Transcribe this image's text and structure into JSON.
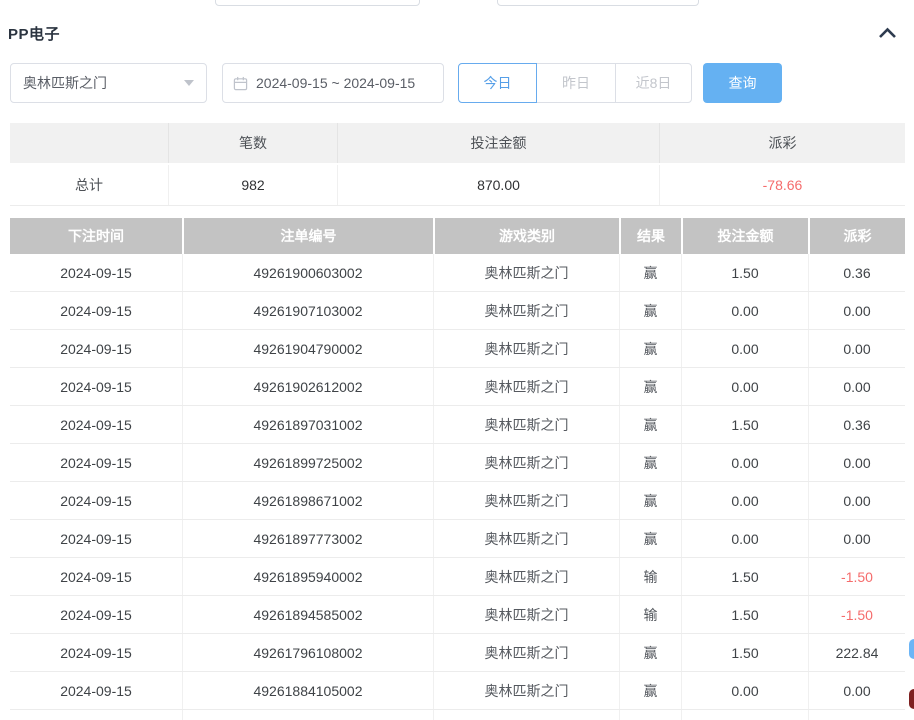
{
  "panel": {
    "title": "PP电子"
  },
  "filters": {
    "game_select": {
      "value": "奥林匹斯之门"
    },
    "date_range": {
      "value": "2024-09-15 ~ 2024-09-15"
    },
    "quick_ranges": [
      {
        "label": "今日",
        "active": true
      },
      {
        "label": "昨日",
        "active": false
      },
      {
        "label": "近8日",
        "active": false
      }
    ],
    "search_button": "查询"
  },
  "summary_table": {
    "headers": [
      "",
      "笔数",
      "投注金额",
      "派彩"
    ],
    "row": {
      "label": "总计",
      "count": "982",
      "bet_amount": "870.00",
      "payout": "-78.66"
    }
  },
  "main_table": {
    "headers": [
      "下注时间",
      "注单编号",
      "游戏类别",
      "结果",
      "投注金额",
      "派彩"
    ],
    "rows": [
      {
        "date": "2024-09-15",
        "order_id": "49261900603002",
        "game": "奥林匹斯之门",
        "result": "赢",
        "bet": "1.50",
        "payout": "0.36"
      },
      {
        "date": "2024-09-15",
        "order_id": "49261907103002",
        "game": "奥林匹斯之门",
        "result": "赢",
        "bet": "0.00",
        "payout": "0.00"
      },
      {
        "date": "2024-09-15",
        "order_id": "49261904790002",
        "game": "奥林匹斯之门",
        "result": "赢",
        "bet": "0.00",
        "payout": "0.00"
      },
      {
        "date": "2024-09-15",
        "order_id": "49261902612002",
        "game": "奥林匹斯之门",
        "result": "赢",
        "bet": "0.00",
        "payout": "0.00"
      },
      {
        "date": "2024-09-15",
        "order_id": "49261897031002",
        "game": "奥林匹斯之门",
        "result": "赢",
        "bet": "1.50",
        "payout": "0.36"
      },
      {
        "date": "2024-09-15",
        "order_id": "49261899725002",
        "game": "奥林匹斯之门",
        "result": "赢",
        "bet": "0.00",
        "payout": "0.00"
      },
      {
        "date": "2024-09-15",
        "order_id": "49261898671002",
        "game": "奥林匹斯之门",
        "result": "赢",
        "bet": "0.00",
        "payout": "0.00"
      },
      {
        "date": "2024-09-15",
        "order_id": "49261897773002",
        "game": "奥林匹斯之门",
        "result": "赢",
        "bet": "0.00",
        "payout": "0.00"
      },
      {
        "date": "2024-09-15",
        "order_id": "49261895940002",
        "game": "奥林匹斯之门",
        "result": "输",
        "bet": "1.50",
        "payout": "-1.50"
      },
      {
        "date": "2024-09-15",
        "order_id": "49261894585002",
        "game": "奥林匹斯之门",
        "result": "输",
        "bet": "1.50",
        "payout": "-1.50"
      },
      {
        "date": "2024-09-15",
        "order_id": "49261796108002",
        "game": "奥林匹斯之门",
        "result": "赢",
        "bet": "1.50",
        "payout": "222.84"
      },
      {
        "date": "2024-09-15",
        "order_id": "49261884105002",
        "game": "奥林匹斯之门",
        "result": "赢",
        "bet": "0.00",
        "payout": "0.00"
      }
    ]
  },
  "colors": {
    "accent_blue": "#65b1f2",
    "active_border_blue": "#67abee",
    "negative_red": "#f56c6c",
    "table_header_gray": "#c3c3c3",
    "summary_header_gray": "#f1f1f1"
  },
  "icons": {
    "collapse": "chevron-up",
    "date": "calendar",
    "select": "caret-down"
  }
}
